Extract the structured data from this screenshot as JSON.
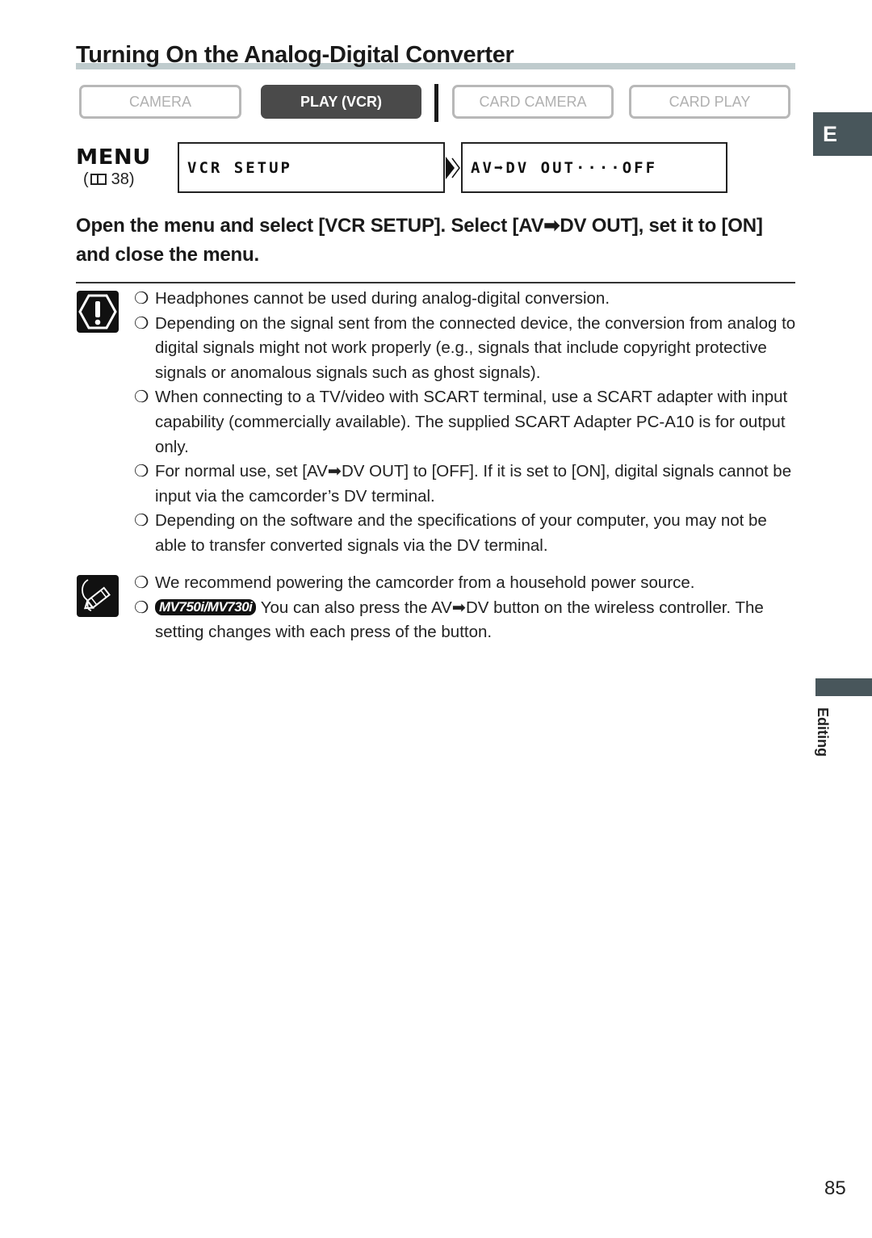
{
  "page": {
    "title": "Turning On the Analog-Digital Converter",
    "language_tab": "E",
    "section_label": "Editing",
    "page_number": "85"
  },
  "modes": [
    {
      "label": "CAMERA",
      "active": false
    },
    {
      "label": "PLAY (VCR)",
      "active": true
    },
    {
      "label": "CARD CAMERA",
      "active": false
    },
    {
      "label": "CARD PLAY",
      "active": false
    }
  ],
  "menu": {
    "label": "MENU",
    "ref_open": "(",
    "ref_page": "38)",
    "icon": "book-icon",
    "screen1": "VCR SETUP",
    "screen2": "AV➡DV OUT····OFF"
  },
  "instruction": "Open the menu and select [VCR SETUP]. Select [AV➡DV OUT], set it to [ON] and close the menu.",
  "cautions": {
    "icon": "caution-icon",
    "items": [
      "Headphones cannot be used during analog-digital conversion.",
      "Depending on the signal sent from the connected device, the conversion from analog to digital signals might not work properly (e.g., signals that include copyright protective signals or anomalous signals such as ghost signals).",
      "When connecting to a TV/video with SCART terminal, use a SCART adapter with input capability (commercially available). The supplied SCART Adapter PC-A10 is for output only.",
      "For normal use, set [AV➡DV OUT] to [OFF]. If it is set to [ON], digital signals cannot be input via the camcorder’s DV terminal.",
      "Depending on the software and the specifications of your computer, you may not be able to transfer converted signals via the DV terminal."
    ]
  },
  "notes": {
    "icon": "note-pencil-icon",
    "items": [
      {
        "badge": "",
        "text": "We recommend powering the camcorder from a household power source."
      },
      {
        "badge": "MV750i/MV730i",
        "text": "You can also press the AV➡DV button on the wireless controller. The setting changes with each press of the button."
      }
    ]
  },
  "bullet": "❍"
}
